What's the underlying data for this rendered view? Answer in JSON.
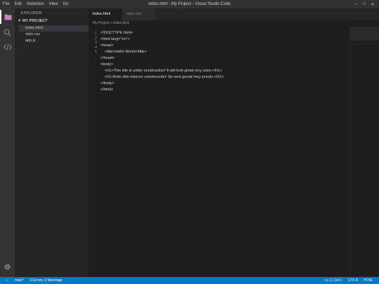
{
  "menu": [
    "File",
    "Edit",
    "Selection",
    "View",
    "Go"
  ],
  "window": {
    "title": "index.html - My Project - Visual Studio Code",
    "minimize": "–",
    "maximize": "□",
    "close": "✕"
  },
  "activitybar": {
    "icons": [
      "files-icon",
      "search-icon",
      "code-icon",
      "settings-gear-icon"
    ]
  },
  "sidebar": {
    "title": "EXPLORER",
    "folder": "▼ MY PROJECT",
    "files": [
      "index.html",
      "style.css",
      "app.js"
    ]
  },
  "tabs": [
    "index.html",
    "style.css"
  ],
  "breadcrumb": "My Project > index.html",
  "editor": {
    "line_numbers": [
      "1",
      "2",
      "3",
      "4",
      "5"
    ],
    "lines": [
      "<!DOCTYPE html>",
      "<html lang=\"en\">",
      "<head>",
      "    <title>Hello World</title>",
      "</head>",
      "<body>",
      "    <h1>This site is under construction! It will look great very soon.</h1>",
      "    <h1>Este sitio está en construcción! Se verá genial muy pronto.</h1>",
      "</body>",
      "</html>"
    ]
  },
  "statusbar": {
    "branch_icon": "⑂",
    "branch": "main*",
    "problems": "0 Errors, 0 Warnings",
    "position": "Ln 1, Col 1",
    "encoding": "UTF-8",
    "language": "HTML"
  },
  "colors": {
    "accent": "#007acc",
    "files_icon_active": "#c586c0"
  }
}
